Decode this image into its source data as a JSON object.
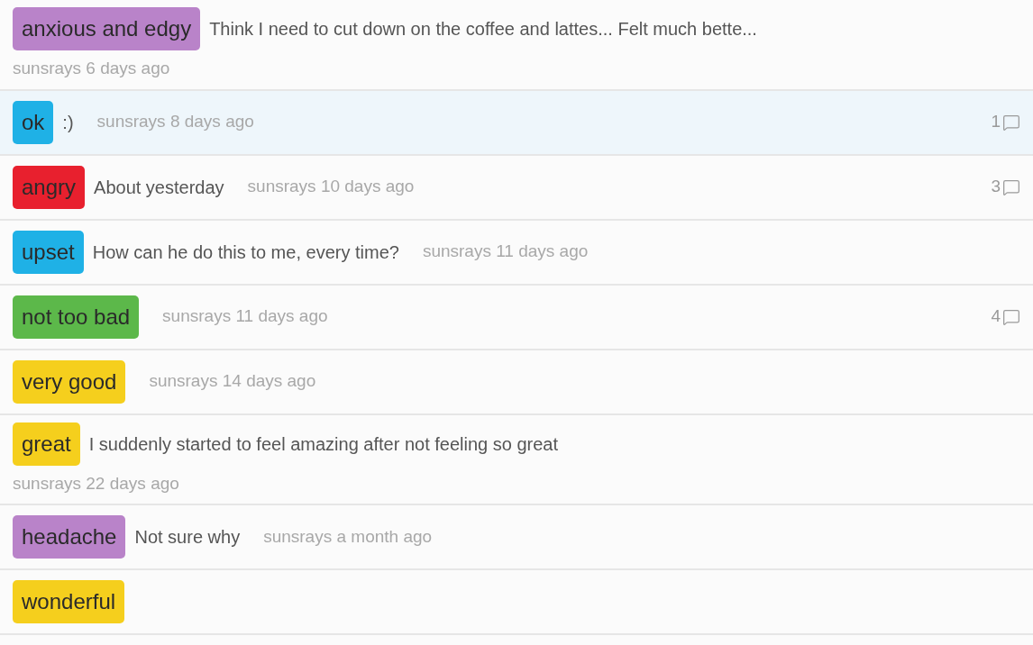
{
  "entries": [
    {
      "mood": "anxious and edgy",
      "color": "#b983c9",
      "note": "Think I need to cut down on the coffee and lattes... Felt much bette...",
      "user": "sunsrays",
      "time": "6 days ago",
      "selected": false,
      "kind": "stacked"
    },
    {
      "mood": "ok",
      "color": "#1fb1e6",
      "note": ":)",
      "user": "sunsrays",
      "time": "8 days ago",
      "comments": "1",
      "selected": true,
      "kind": "inline"
    },
    {
      "mood": "angry",
      "color": "#e8202e",
      "note": "About yesterday",
      "user": "sunsrays",
      "time": "10 days ago",
      "comments": "3",
      "selected": false,
      "kind": "inline"
    },
    {
      "mood": "upset",
      "color": "#1fb1e6",
      "note": "How can he do this to me, every time?",
      "user": "sunsrays",
      "time": "11 days ago",
      "selected": false,
      "kind": "inline"
    },
    {
      "mood": "not too bad",
      "color": "#5cb84a",
      "user": "sunsrays",
      "time": "11 days ago",
      "comments": "4",
      "selected": false,
      "kind": "inline"
    },
    {
      "mood": "very good",
      "color": "#f5cf1d",
      "user": "sunsrays",
      "time": "14 days ago",
      "selected": false,
      "kind": "inline"
    },
    {
      "mood": "great",
      "color": "#f5cf1d",
      "note": "I suddenly started to feel amazing after not feeling so great",
      "user": "sunsrays",
      "time": "22 days ago",
      "selected": false,
      "kind": "stacked"
    },
    {
      "mood": "headache",
      "color": "#b983c9",
      "note": "Not sure why",
      "user": "sunsrays",
      "time": "a month ago",
      "selected": false,
      "kind": "inline"
    },
    {
      "mood": "wonderful",
      "color": "#f5cf1d",
      "selected": false,
      "kind": "inline"
    }
  ]
}
